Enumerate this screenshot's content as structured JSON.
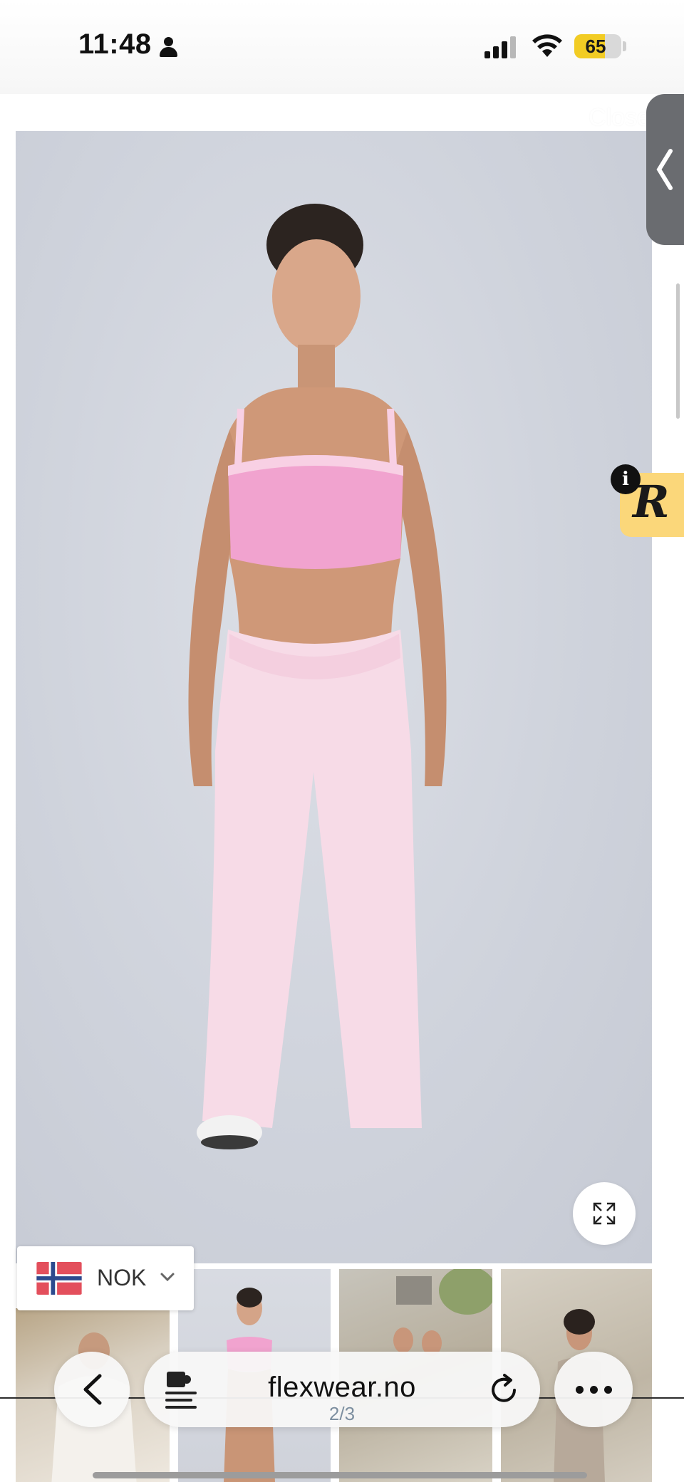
{
  "status_bar": {
    "time": "11:48",
    "battery_level": "65",
    "battery_fraction": 0.65,
    "icons": [
      "person-icon",
      "cellular-signal-icon",
      "wifi-icon",
      "battery-icon"
    ]
  },
  "lightbox": {
    "close_label": "Close",
    "image_counter": "2/3",
    "thumbnails": [
      {
        "name": "thumbnail-1",
        "description_icon": "photo-thumbnail"
      },
      {
        "name": "thumbnail-2",
        "description_icon": "photo-thumbnail"
      },
      {
        "name": "thumbnail-3",
        "description_icon": "photo-thumbnail"
      },
      {
        "name": "thumbnail-4",
        "description_icon": "photo-thumbnail"
      }
    ]
  },
  "reviews_badge": {
    "letter": "R",
    "info_glyph": "i"
  },
  "currency_selector": {
    "code": "NOK",
    "flag": "norway-flag-icon"
  },
  "browser": {
    "domain": "flexwear.no"
  },
  "colors": {
    "badge_yellow": "#fbd77a",
    "battery_yellow": "#f2cc24",
    "tab_gray": "#6a6c70",
    "counter_text": "#7d8fa0"
  }
}
